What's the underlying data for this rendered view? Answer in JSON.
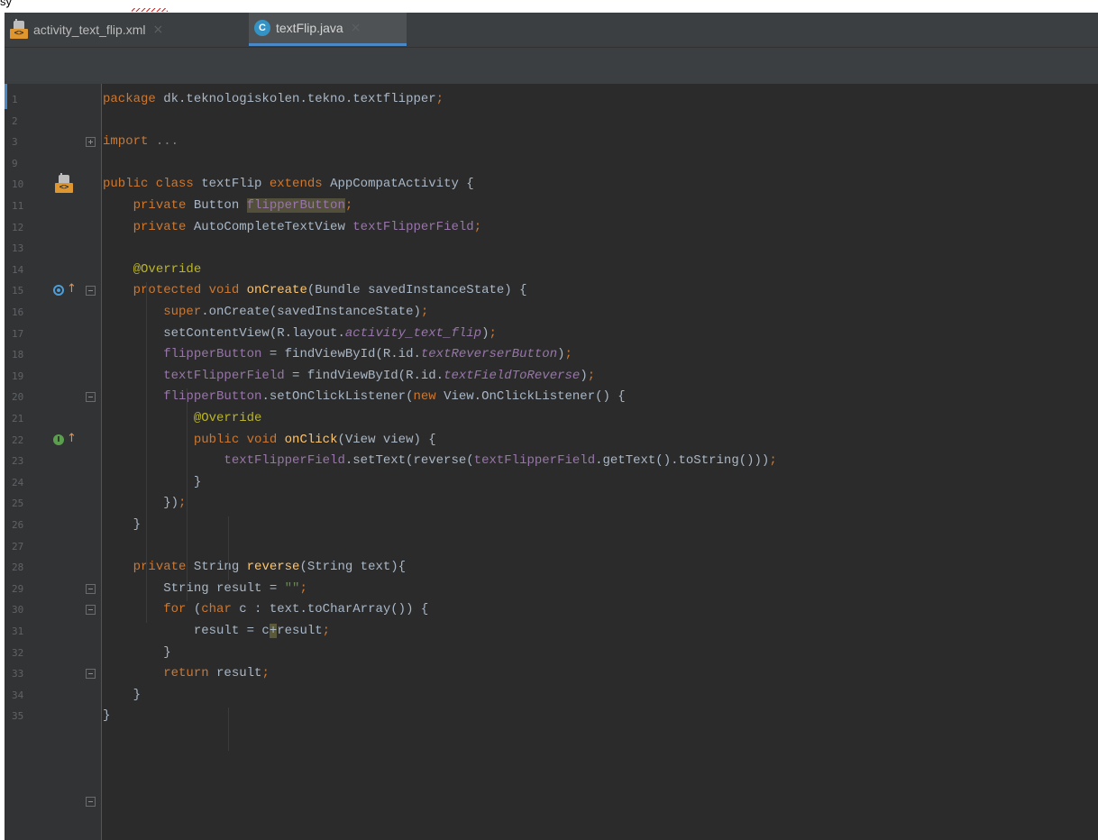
{
  "doc_fragment": "sy",
  "tabs": [
    {
      "label": "activity_text_flip.xml",
      "icon": "xml-layout-icon",
      "close": "×",
      "active": false
    },
    {
      "label": "textFlip.java",
      "icon": "java-class-icon",
      "close": "×",
      "active": true
    }
  ],
  "tab_icon_glyphs": {
    "xml": "<>",
    "class": "C"
  },
  "gutter_icon_glyphs": {
    "implement": "I",
    "arrow": "↑"
  },
  "colors": {
    "keyword": "#cc7832",
    "field": "#9876aa",
    "method": "#ffc66d",
    "annotation": "#bbb529",
    "string": "#6a8759",
    "text": "#a9b7c6",
    "background": "#2b2b2b",
    "tab_underline": "#4a88c7"
  },
  "lines": [
    {
      "n": "1",
      "tokens": [
        [
          "kw",
          "package "
        ],
        [
          "t",
          "dk.teknologiskolen.tekno.textflipper"
        ],
        [
          "kw",
          ";"
        ]
      ]
    },
    {
      "n": "2",
      "tokens": []
    },
    {
      "n": "3",
      "tokens": [
        [
          "kw",
          "import "
        ],
        [
          "fold",
          "..."
        ]
      ]
    },
    {
      "n": "9",
      "tokens": []
    },
    {
      "n": "10",
      "tokens": [
        [
          "kw",
          "public class "
        ],
        [
          "t",
          "textFlip "
        ],
        [
          "kw",
          "extends "
        ],
        [
          "t",
          "AppCompatActivity {"
        ]
      ]
    },
    {
      "n": "11",
      "tokens": [
        [
          "t",
          "    "
        ],
        [
          "kw",
          "private "
        ],
        [
          "t",
          "Button "
        ],
        [
          "hlf",
          "flipperButton"
        ],
        [
          "kw",
          ";"
        ]
      ]
    },
    {
      "n": "12",
      "tokens": [
        [
          "t",
          "    "
        ],
        [
          "kw",
          "private "
        ],
        [
          "t",
          "AutoCompleteTextView "
        ],
        [
          "fld",
          "textFlipperField"
        ],
        [
          "kw",
          ";"
        ]
      ]
    },
    {
      "n": "13",
      "tokens": []
    },
    {
      "n": "14",
      "tokens": [
        [
          "t",
          "    "
        ],
        [
          "ann",
          "@Override"
        ]
      ]
    },
    {
      "n": "15",
      "tokens": [
        [
          "t",
          "    "
        ],
        [
          "kw",
          "protected void "
        ],
        [
          "fn",
          "onCreate"
        ],
        [
          "t",
          "(Bundle savedInstanceState) {"
        ]
      ]
    },
    {
      "n": "16",
      "tokens": [
        [
          "t",
          "        "
        ],
        [
          "kw",
          "super"
        ],
        [
          "t",
          ".onCreate(savedInstanceState)"
        ],
        [
          "kw",
          ";"
        ]
      ]
    },
    {
      "n": "17",
      "tokens": [
        [
          "t",
          "        setContentView(R.layout."
        ],
        [
          "ifld",
          "activity_text_flip"
        ],
        [
          "t",
          ")"
        ],
        [
          "kw",
          ";"
        ]
      ]
    },
    {
      "n": "18",
      "tokens": [
        [
          "t",
          "        "
        ],
        [
          "fld",
          "flipperButton"
        ],
        [
          "t",
          " = findViewById(R.id."
        ],
        [
          "ifld",
          "textReverserButton"
        ],
        [
          "t",
          ")"
        ],
        [
          "kw",
          ";"
        ]
      ]
    },
    {
      "n": "19",
      "tokens": [
        [
          "t",
          "        "
        ],
        [
          "fld",
          "textFlipperField"
        ],
        [
          "t",
          " = findViewById(R.id."
        ],
        [
          "ifld",
          "textFieldToReverse"
        ],
        [
          "t",
          ")"
        ],
        [
          "kw",
          ";"
        ]
      ]
    },
    {
      "n": "20",
      "tokens": [
        [
          "t",
          "        "
        ],
        [
          "fld",
          "flipperButton"
        ],
        [
          "t",
          ".setOnClickListener("
        ],
        [
          "kw",
          "new "
        ],
        [
          "t",
          "View.OnClickListener() {"
        ]
      ]
    },
    {
      "n": "21",
      "tokens": [
        [
          "t",
          "            "
        ],
        [
          "ann",
          "@Override"
        ]
      ]
    },
    {
      "n": "22",
      "tokens": [
        [
          "t",
          "            "
        ],
        [
          "kw",
          "public void "
        ],
        [
          "fn",
          "onClick"
        ],
        [
          "t",
          "(View view) {"
        ]
      ]
    },
    {
      "n": "23",
      "tokens": [
        [
          "t",
          "                "
        ],
        [
          "fld",
          "textFlipperField"
        ],
        [
          "t",
          ".setText(reverse("
        ],
        [
          "fld",
          "textFlipperField"
        ],
        [
          "t",
          ".getText().toString()))"
        ],
        [
          "kw",
          ";"
        ]
      ]
    },
    {
      "n": "24",
      "tokens": [
        [
          "t",
          "            }"
        ]
      ]
    },
    {
      "n": "25",
      "tokens": [
        [
          "t",
          "        })"
        ],
        [
          "kw",
          ";"
        ]
      ]
    },
    {
      "n": "26",
      "tokens": [
        [
          "t",
          "    }"
        ]
      ]
    },
    {
      "n": "27",
      "tokens": []
    },
    {
      "n": "28",
      "tokens": [
        [
          "t",
          "    "
        ],
        [
          "kw",
          "private "
        ],
        [
          "t",
          "String "
        ],
        [
          "fn",
          "reverse"
        ],
        [
          "t",
          "(String text){"
        ]
      ]
    },
    {
      "n": "29",
      "tokens": [
        [
          "t",
          "        String result = "
        ],
        [
          "str",
          "\"\""
        ],
        [
          "kw",
          ";"
        ]
      ]
    },
    {
      "n": "30",
      "tokens": [
        [
          "t",
          "        "
        ],
        [
          "kw",
          "for "
        ],
        [
          "t",
          "("
        ],
        [
          "kw",
          "char "
        ],
        [
          "t",
          "c : text.toCharArray()) {"
        ]
      ]
    },
    {
      "n": "31",
      "tokens": [
        [
          "t",
          "            result = c"
        ],
        [
          "caret",
          "+"
        ],
        [
          "t",
          "result"
        ],
        [
          "kw",
          ";"
        ]
      ]
    },
    {
      "n": "32",
      "tokens": [
        [
          "t",
          "        }"
        ]
      ]
    },
    {
      "n": "33",
      "tokens": [
        [
          "t",
          "        "
        ],
        [
          "kw",
          "return "
        ],
        [
          "t",
          "result"
        ],
        [
          "kw",
          ";"
        ]
      ]
    },
    {
      "n": "34",
      "tokens": [
        [
          "t",
          "    }"
        ]
      ]
    },
    {
      "n": "35",
      "tokens": [
        [
          "t",
          "}"
        ]
      ]
    }
  ]
}
